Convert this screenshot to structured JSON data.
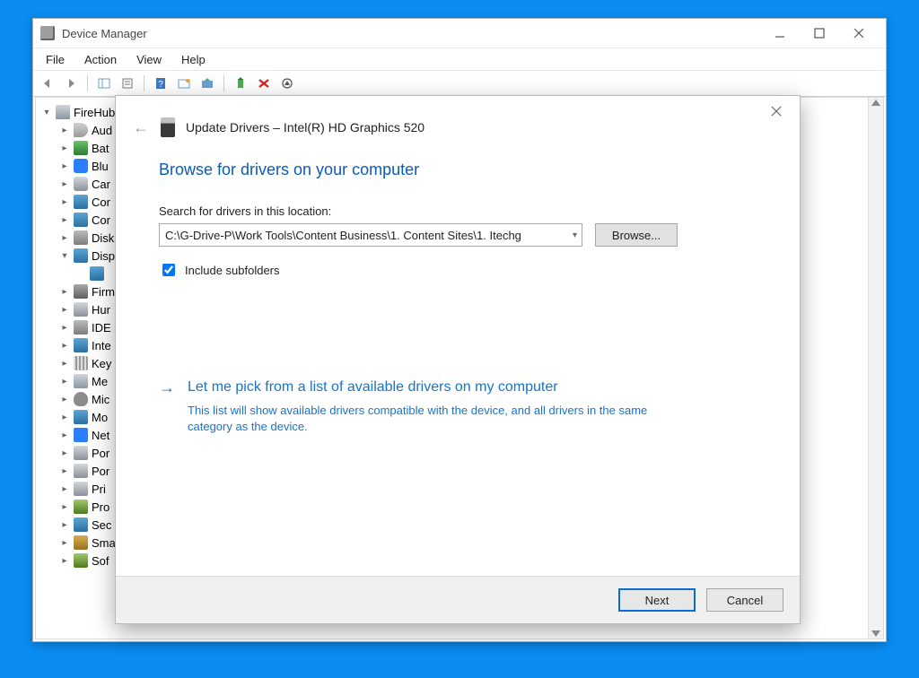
{
  "window": {
    "title": "Device Manager",
    "menubar": {
      "file": "File",
      "action": "Action",
      "view": "View",
      "help": "Help"
    }
  },
  "tree": {
    "root": "FireHub",
    "items": [
      {
        "label": "Aud",
        "icon": "audio",
        "caret": "closed",
        "name": "audio-inputs"
      },
      {
        "label": "Bat",
        "icon": "batt",
        "caret": "closed",
        "name": "batteries"
      },
      {
        "label": "Blu",
        "icon": "bt",
        "caret": "closed",
        "name": "bluetooth"
      },
      {
        "label": "Car",
        "icon": "cam",
        "caret": "closed",
        "name": "cameras"
      },
      {
        "label": "Cor",
        "icon": "mon",
        "caret": "closed",
        "name": "computer"
      },
      {
        "label": "Cor",
        "icon": "mon",
        "caret": "closed",
        "name": "computer-2"
      },
      {
        "label": "Disk",
        "icon": "disk",
        "caret": "closed",
        "name": "disk-drives"
      },
      {
        "label": "Disp",
        "icon": "mon",
        "caret": "open",
        "name": "display-adapters"
      },
      {
        "label": "",
        "icon": "mon",
        "caret": "none",
        "name": "display-adapter-child",
        "indent": 2
      },
      {
        "label": "Firm",
        "icon": "firm",
        "caret": "closed",
        "name": "firmware"
      },
      {
        "label": "Hur",
        "icon": "hid",
        "caret": "closed",
        "name": "hid"
      },
      {
        "label": "IDE",
        "icon": "ide",
        "caret": "closed",
        "name": "ide"
      },
      {
        "label": "Inte",
        "icon": "mon",
        "caret": "closed",
        "name": "intel"
      },
      {
        "label": "Key",
        "icon": "kb",
        "caret": "closed",
        "name": "keyboards"
      },
      {
        "label": "Me",
        "icon": "mem",
        "caret": "closed",
        "name": "memory"
      },
      {
        "label": "Mic",
        "icon": "mouse",
        "caret": "closed",
        "name": "mice"
      },
      {
        "label": "Mo",
        "icon": "mon",
        "caret": "closed",
        "name": "monitors"
      },
      {
        "label": "Net",
        "icon": "net",
        "caret": "closed",
        "name": "network"
      },
      {
        "label": "Por",
        "icon": "port",
        "caret": "closed",
        "name": "portable"
      },
      {
        "label": "Por",
        "icon": "port",
        "caret": "closed",
        "name": "ports"
      },
      {
        "label": "Pri",
        "icon": "print",
        "caret": "closed",
        "name": "print-queues"
      },
      {
        "label": "Pro",
        "icon": "proc",
        "caret": "closed",
        "name": "processors"
      },
      {
        "label": "Sec",
        "icon": "sec",
        "caret": "closed",
        "name": "security"
      },
      {
        "label": "Sma",
        "icon": "sma",
        "caret": "closed",
        "name": "smartcard"
      },
      {
        "label": "Sof",
        "icon": "soft",
        "caret": "closed",
        "name": "software"
      }
    ]
  },
  "wizard": {
    "title": "Update Drivers – Intel(R) HD Graphics 520",
    "heading": "Browse for drivers on your computer",
    "search_label": "Search for drivers in this location:",
    "path_value": "C:\\G-Drive-P\\Work Tools\\Content Business\\1. Content Sites\\1. Itechg",
    "browse": "Browse...",
    "include_subfolders": "Include subfolders",
    "include_checked": true,
    "pick_title": "Let me pick from a list of available drivers on my computer",
    "pick_desc": "This list will show available drivers compatible with the device, and all drivers in the same category as the device.",
    "next": "Next",
    "cancel": "Cancel"
  }
}
